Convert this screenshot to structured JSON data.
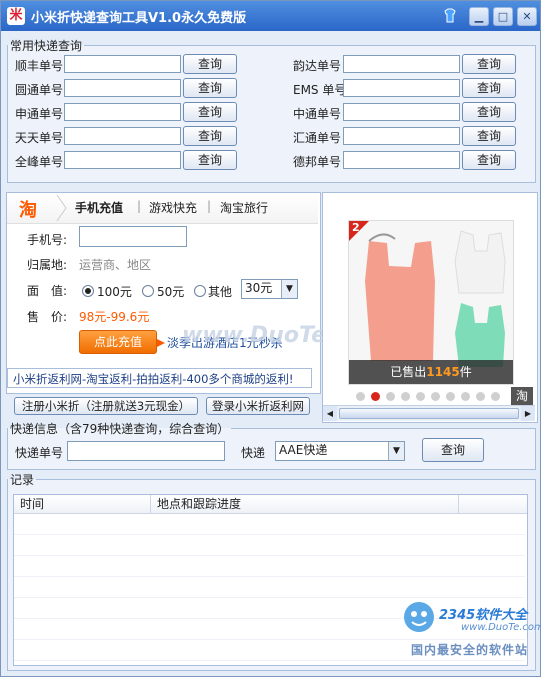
{
  "window": {
    "title": "小米折快递查询工具V1.0永久免费版"
  },
  "common": {
    "legend": "常用快递查询",
    "left": [
      {
        "label": "顺丰单号",
        "button": "查询"
      },
      {
        "label": "圆通单号",
        "button": "查询"
      },
      {
        "label": "申通单号",
        "button": "查询"
      },
      {
        "label": "天天单号",
        "button": "查询"
      },
      {
        "label": "全峰单号",
        "button": "查询"
      }
    ],
    "right": [
      {
        "label": "韵达单号",
        "button": "查询"
      },
      {
        "label": "EMS 单号",
        "button": "查询"
      },
      {
        "label": "中通单号",
        "button": "查询"
      },
      {
        "label": "汇通单号",
        "button": "查询"
      },
      {
        "label": "德邦单号",
        "button": "查询"
      }
    ]
  },
  "ad": {
    "logo": "淘",
    "tabs": [
      "手机充值",
      "游戏快充",
      "淘宝旅行"
    ],
    "phone_label": "手机号:",
    "region_label": "归属地:",
    "region_placeholder": "运营商、地区",
    "face_label": "面　值:",
    "radios": [
      "100元",
      "50元",
      "其他"
    ],
    "other_value": "30元",
    "price_label": "售　价:",
    "price_value": "98元-99.6元",
    "charge_button": "点此充值",
    "promo_text": "淡季出游酒店1元秒杀"
  },
  "product": {
    "badge": "2",
    "sold_prefix": "已售出",
    "sold_count": "1145",
    "sold_suffix": "件",
    "taobao_mark": "淘"
  },
  "banner": {
    "text": "小米折返利网-淘宝返利-拍拍返利-400多个商城的返利!"
  },
  "links": {
    "register": "注册小米折（注册就送3元现金）",
    "login": "登录小米折返利网"
  },
  "express": {
    "legend": "快递信息（含79种快递查询，综合查询）",
    "number_label": "快递单号",
    "company_label": "快递",
    "company_value": "AAE快递",
    "button": "查询"
  },
  "records": {
    "legend": "记录",
    "columns": [
      "时间",
      "地点和跟踪进度"
    ]
  },
  "watermark": {
    "brand": "2345软件大全",
    "url": "www.DuoTe.com",
    "slogan": "国内最安全的软件站",
    "center": "www.DuoTe.com"
  }
}
